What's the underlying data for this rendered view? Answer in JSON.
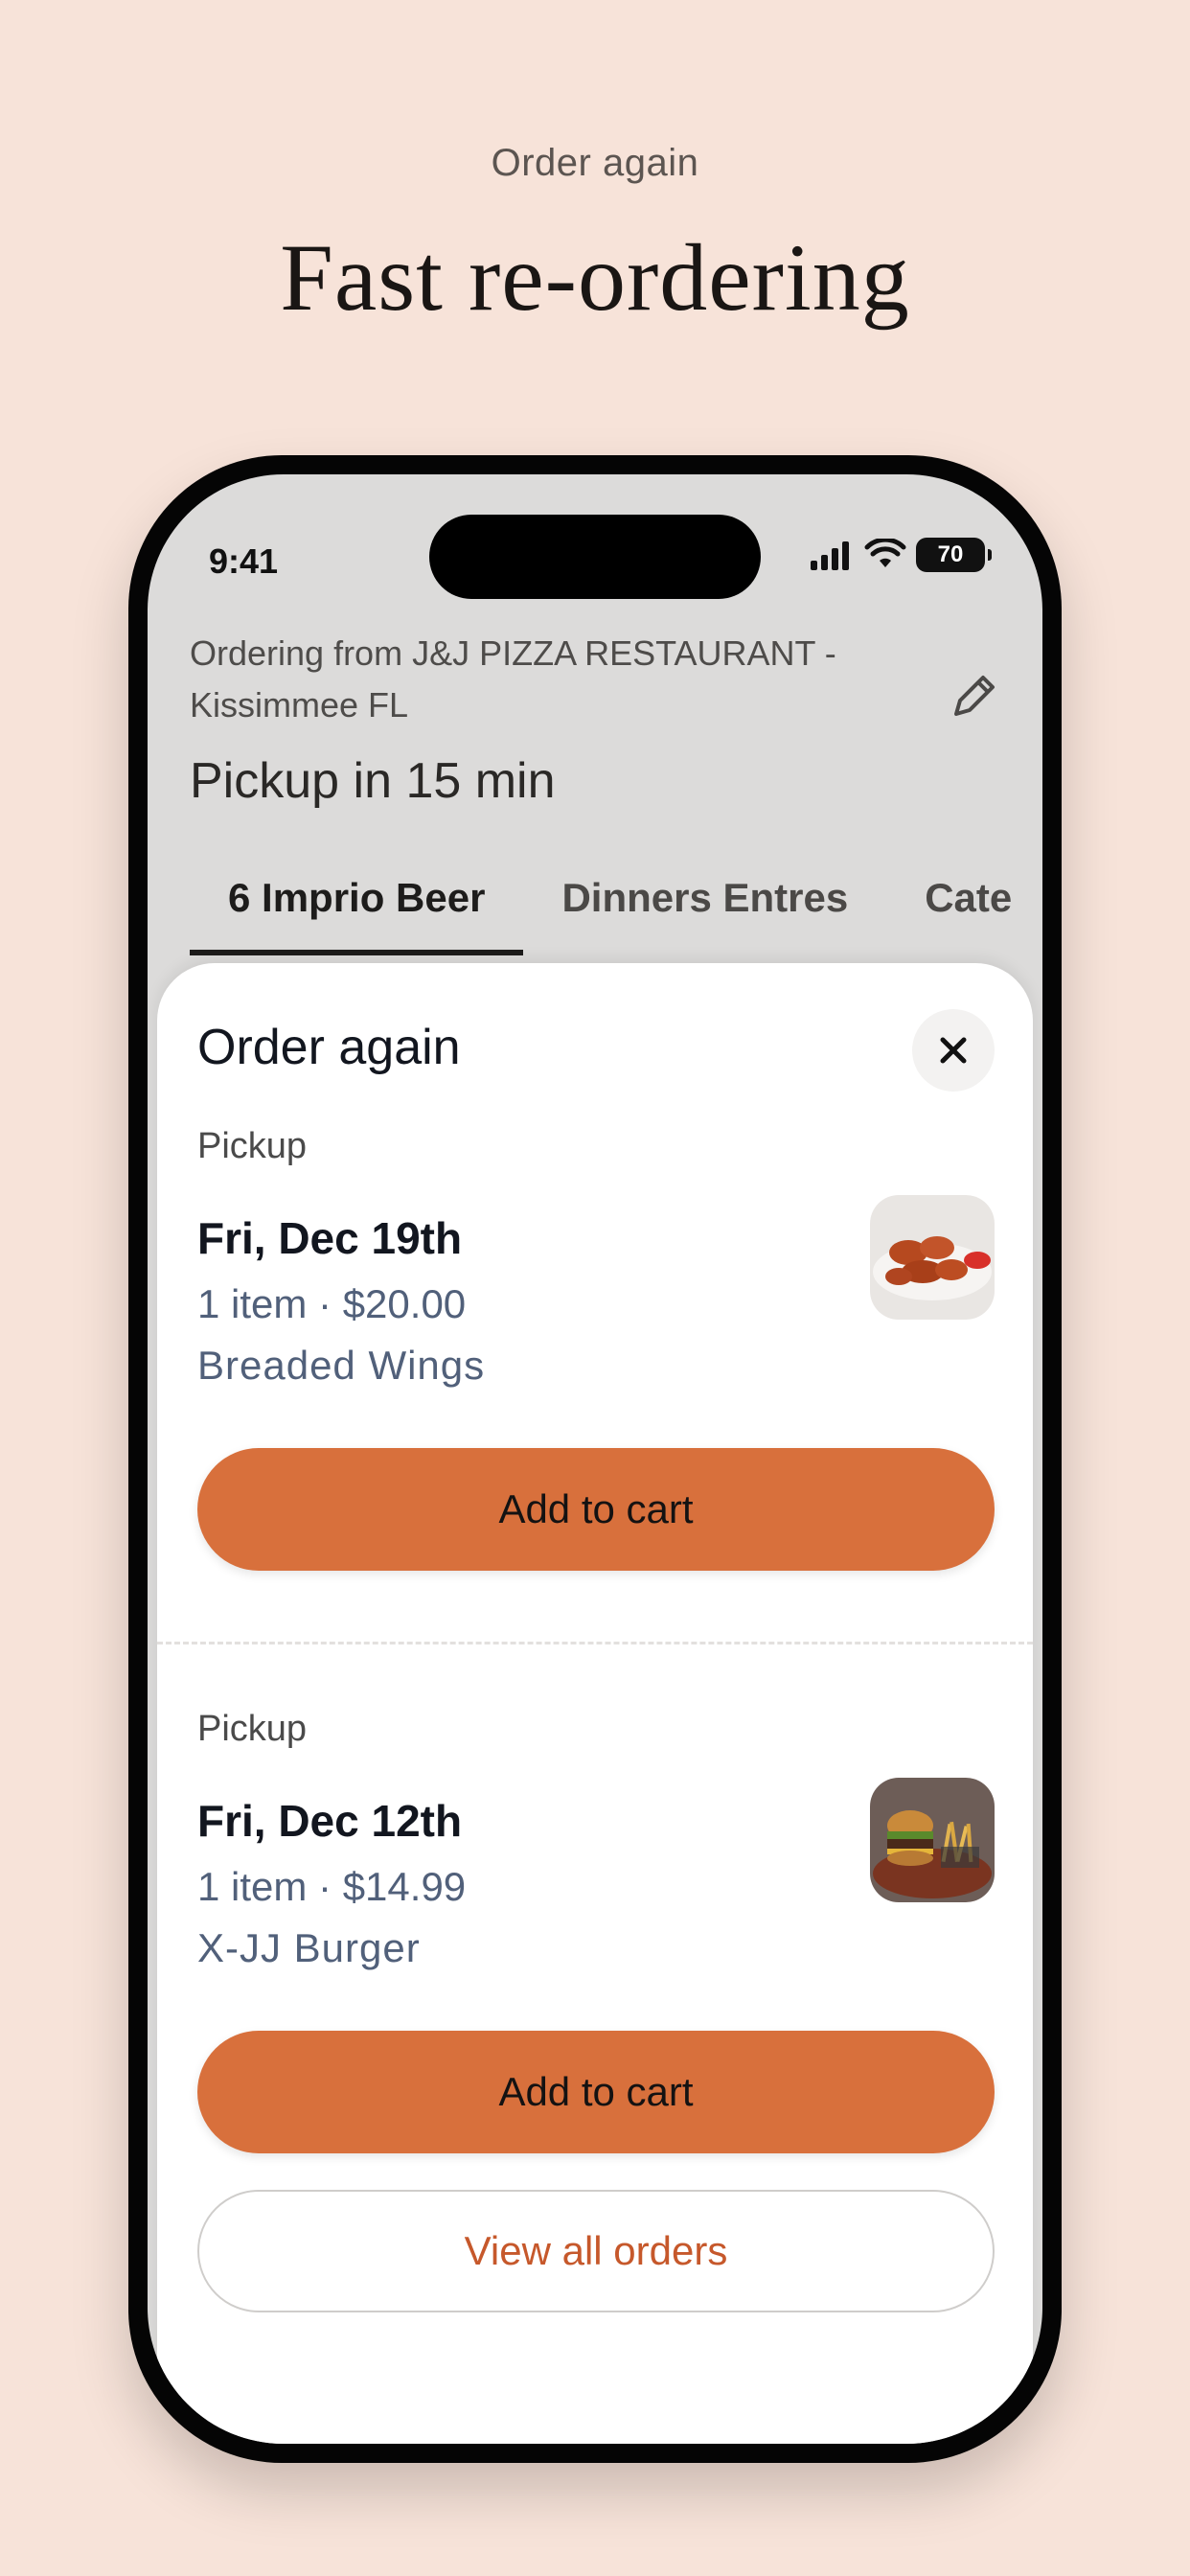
{
  "hero": {
    "eyebrow": "Order again",
    "headline": "Fast re-ordering"
  },
  "status_bar": {
    "time": "9:41",
    "battery": "70",
    "icons": [
      "signal-icon",
      "wifi-icon",
      "battery-icon"
    ]
  },
  "header": {
    "ordering_from": "Ordering from J&J PIZZA RESTAURANT - Kissimmee FL",
    "pickup_time": "Pickup in 15 min",
    "edit_icon": "pencil-icon"
  },
  "tabs": [
    {
      "label": "6 Imprio Beer",
      "active": true
    },
    {
      "label": "Dinners Entres",
      "active": false
    },
    {
      "label": "Cate",
      "active": false
    }
  ],
  "sheet": {
    "title": "Order again",
    "close_icon": "close-icon",
    "orders": [
      {
        "type": "Pickup",
        "date": "Fri, Dec 19th",
        "summary": "1 item · $20.00",
        "item": "Breaded Wings",
        "image": "chicken-wings-photo",
        "button": "Add to cart"
      },
      {
        "type": "Pickup",
        "date": "Fri, Dec 12th",
        "summary": "1 item · $14.99",
        "item": "X-JJ Burger",
        "image": "burger-photo",
        "button": "Add to cart"
      }
    ],
    "view_all": "View all orders"
  },
  "colors": {
    "background": "#f7e3d9",
    "accent": "#d8703c",
    "link": "#c6582b"
  }
}
